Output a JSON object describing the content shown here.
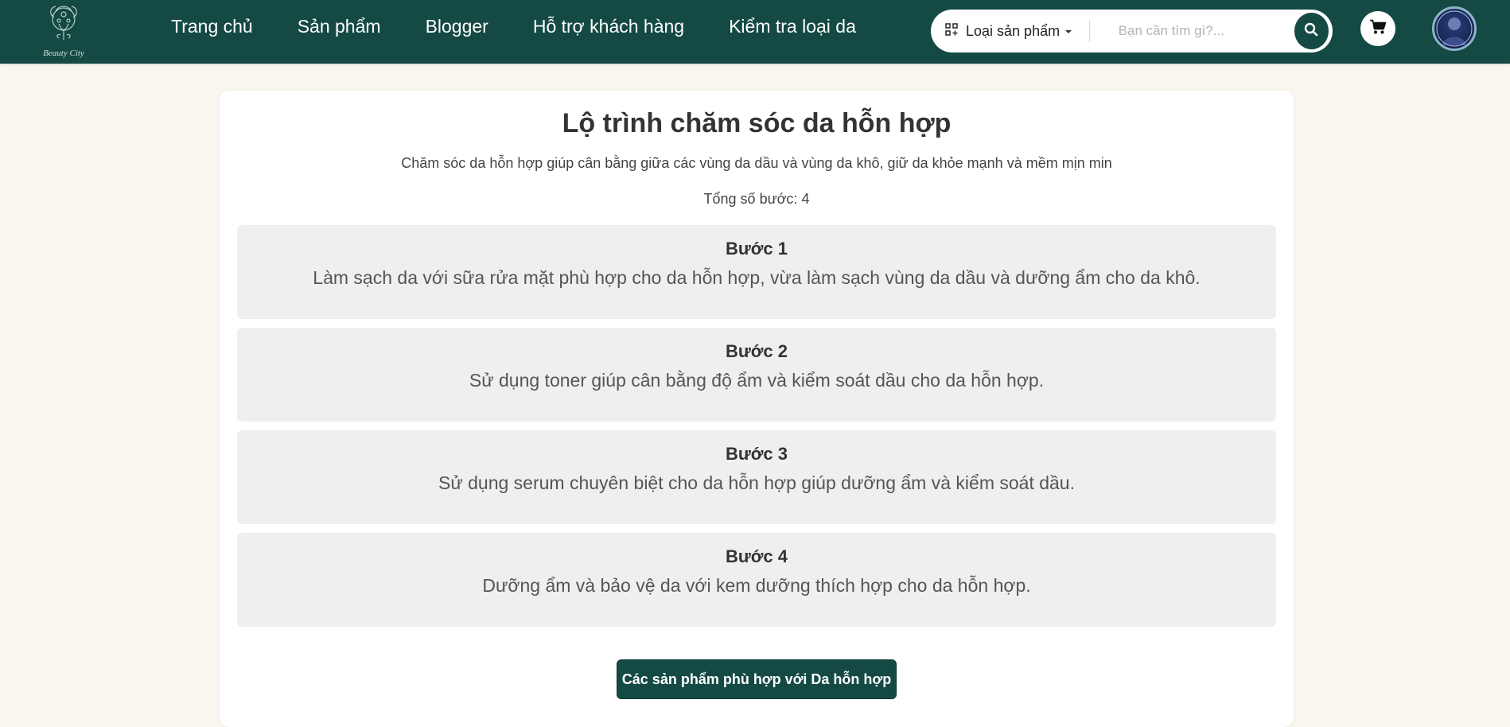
{
  "brand": {
    "logo_text": "Beauty City"
  },
  "nav": {
    "links": [
      {
        "label": "Trang chủ"
      },
      {
        "label": "Sản phẩm"
      },
      {
        "label": "Blogger"
      },
      {
        "label": "Hỗ trợ khách hàng"
      },
      {
        "label": "Kiểm tra loại da"
      }
    ]
  },
  "search": {
    "category_label": "Loại sản phẩm",
    "placeholder": "Bạn cần tìm gì?...",
    "value": ""
  },
  "icons": {
    "category": "grid-icon",
    "dropdown": "caret-down-icon",
    "search": "search-icon",
    "cart": "cart-icon"
  },
  "colors": {
    "primary": "#144a43",
    "page_background": "#f9f5ef",
    "card_background": "#ffffff",
    "step_background": "#efefef"
  },
  "routine": {
    "title": "Lộ trình chăm sóc da hỗn hợp",
    "description": "Chăm sóc da hỗn hợp giúp cân bằng giữa các vùng da dầu và vùng da khô, giữ da khỏe mạnh và mềm mịn min",
    "total_steps": "Tổng số bước: 4",
    "steps": [
      {
        "title": "Bước 1",
        "text": "Làm sạch da với sữa rửa mặt phù hợp cho da hỗn hợp, vừa làm sạch vùng da dầu và dưỡng ẩm cho da khô."
      },
      {
        "title": "Bước 2",
        "text": "Sử dụng toner giúp cân bằng độ ẩm và kiểm soát dầu cho da hỗn hợp."
      },
      {
        "title": "Bước 3",
        "text": "Sử dụng serum chuyên biệt cho da hỗn hợp giúp dưỡng ẩm và kiểm soát dầu."
      },
      {
        "title": "Bước 4",
        "text": "Dưỡng ẩm và bảo vệ da với kem dưỡng thích hợp cho da hỗn hợp."
      }
    ],
    "cta_label": "Các sản phẩm phù hợp với Da hỗn hợp"
  }
}
